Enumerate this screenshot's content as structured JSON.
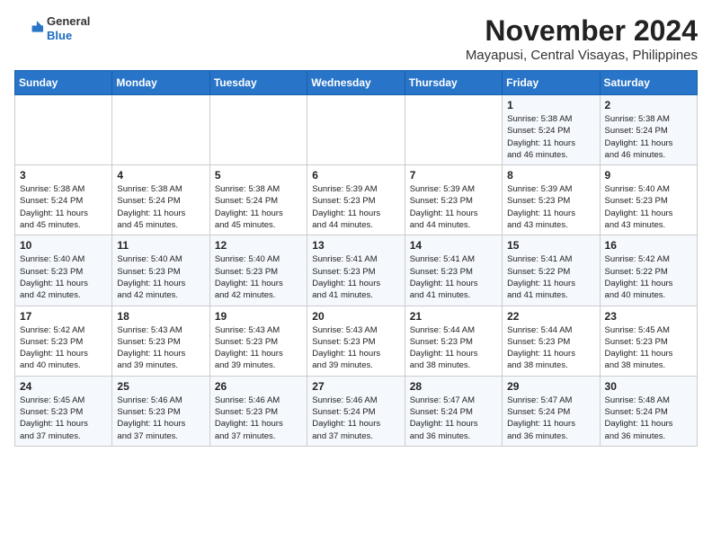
{
  "header": {
    "logo_line1": "General",
    "logo_line2": "Blue",
    "title": "November 2024",
    "subtitle": "Mayapusi, Central Visayas, Philippines"
  },
  "weekdays": [
    "Sunday",
    "Monday",
    "Tuesday",
    "Wednesday",
    "Thursday",
    "Friday",
    "Saturday"
  ],
  "weeks": [
    [
      {
        "day": "",
        "info": ""
      },
      {
        "day": "",
        "info": ""
      },
      {
        "day": "",
        "info": ""
      },
      {
        "day": "",
        "info": ""
      },
      {
        "day": "",
        "info": ""
      },
      {
        "day": "1",
        "info": "Sunrise: 5:38 AM\nSunset: 5:24 PM\nDaylight: 11 hours\nand 46 minutes."
      },
      {
        "day": "2",
        "info": "Sunrise: 5:38 AM\nSunset: 5:24 PM\nDaylight: 11 hours\nand 46 minutes."
      }
    ],
    [
      {
        "day": "3",
        "info": "Sunrise: 5:38 AM\nSunset: 5:24 PM\nDaylight: 11 hours\nand 45 minutes."
      },
      {
        "day": "4",
        "info": "Sunrise: 5:38 AM\nSunset: 5:24 PM\nDaylight: 11 hours\nand 45 minutes."
      },
      {
        "day": "5",
        "info": "Sunrise: 5:38 AM\nSunset: 5:24 PM\nDaylight: 11 hours\nand 45 minutes."
      },
      {
        "day": "6",
        "info": "Sunrise: 5:39 AM\nSunset: 5:23 PM\nDaylight: 11 hours\nand 44 minutes."
      },
      {
        "day": "7",
        "info": "Sunrise: 5:39 AM\nSunset: 5:23 PM\nDaylight: 11 hours\nand 44 minutes."
      },
      {
        "day": "8",
        "info": "Sunrise: 5:39 AM\nSunset: 5:23 PM\nDaylight: 11 hours\nand 43 minutes."
      },
      {
        "day": "9",
        "info": "Sunrise: 5:40 AM\nSunset: 5:23 PM\nDaylight: 11 hours\nand 43 minutes."
      }
    ],
    [
      {
        "day": "10",
        "info": "Sunrise: 5:40 AM\nSunset: 5:23 PM\nDaylight: 11 hours\nand 42 minutes."
      },
      {
        "day": "11",
        "info": "Sunrise: 5:40 AM\nSunset: 5:23 PM\nDaylight: 11 hours\nand 42 minutes."
      },
      {
        "day": "12",
        "info": "Sunrise: 5:40 AM\nSunset: 5:23 PM\nDaylight: 11 hours\nand 42 minutes."
      },
      {
        "day": "13",
        "info": "Sunrise: 5:41 AM\nSunset: 5:23 PM\nDaylight: 11 hours\nand 41 minutes."
      },
      {
        "day": "14",
        "info": "Sunrise: 5:41 AM\nSunset: 5:23 PM\nDaylight: 11 hours\nand 41 minutes."
      },
      {
        "day": "15",
        "info": "Sunrise: 5:41 AM\nSunset: 5:22 PM\nDaylight: 11 hours\nand 41 minutes."
      },
      {
        "day": "16",
        "info": "Sunrise: 5:42 AM\nSunset: 5:22 PM\nDaylight: 11 hours\nand 40 minutes."
      }
    ],
    [
      {
        "day": "17",
        "info": "Sunrise: 5:42 AM\nSunset: 5:23 PM\nDaylight: 11 hours\nand 40 minutes."
      },
      {
        "day": "18",
        "info": "Sunrise: 5:43 AM\nSunset: 5:23 PM\nDaylight: 11 hours\nand 39 minutes."
      },
      {
        "day": "19",
        "info": "Sunrise: 5:43 AM\nSunset: 5:23 PM\nDaylight: 11 hours\nand 39 minutes."
      },
      {
        "day": "20",
        "info": "Sunrise: 5:43 AM\nSunset: 5:23 PM\nDaylight: 11 hours\nand 39 minutes."
      },
      {
        "day": "21",
        "info": "Sunrise: 5:44 AM\nSunset: 5:23 PM\nDaylight: 11 hours\nand 38 minutes."
      },
      {
        "day": "22",
        "info": "Sunrise: 5:44 AM\nSunset: 5:23 PM\nDaylight: 11 hours\nand 38 minutes."
      },
      {
        "day": "23",
        "info": "Sunrise: 5:45 AM\nSunset: 5:23 PM\nDaylight: 11 hours\nand 38 minutes."
      }
    ],
    [
      {
        "day": "24",
        "info": "Sunrise: 5:45 AM\nSunset: 5:23 PM\nDaylight: 11 hours\nand 37 minutes."
      },
      {
        "day": "25",
        "info": "Sunrise: 5:46 AM\nSunset: 5:23 PM\nDaylight: 11 hours\nand 37 minutes."
      },
      {
        "day": "26",
        "info": "Sunrise: 5:46 AM\nSunset: 5:23 PM\nDaylight: 11 hours\nand 37 minutes."
      },
      {
        "day": "27",
        "info": "Sunrise: 5:46 AM\nSunset: 5:24 PM\nDaylight: 11 hours\nand 37 minutes."
      },
      {
        "day": "28",
        "info": "Sunrise: 5:47 AM\nSunset: 5:24 PM\nDaylight: 11 hours\nand 36 minutes."
      },
      {
        "day": "29",
        "info": "Sunrise: 5:47 AM\nSunset: 5:24 PM\nDaylight: 11 hours\nand 36 minutes."
      },
      {
        "day": "30",
        "info": "Sunrise: 5:48 AM\nSunset: 5:24 PM\nDaylight: 11 hours\nand 36 minutes."
      }
    ]
  ]
}
